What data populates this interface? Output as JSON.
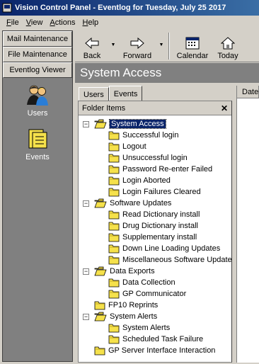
{
  "window": {
    "title": "Vision Control Panel - Eventlog for Tuesday, July  25 2017"
  },
  "menu": [
    {
      "pre": "",
      "key": "F",
      "post": "ile"
    },
    {
      "pre": "",
      "key": "V",
      "post": "iew"
    },
    {
      "pre": "",
      "key": "A",
      "post": "ctions"
    },
    {
      "pre": "",
      "key": "H",
      "post": "elp"
    }
  ],
  "sidebar": {
    "buttons": [
      "Mail Maintenance",
      "File Maintenance",
      "Eventlog Viewer"
    ],
    "items": [
      {
        "label": "Users",
        "icon": "users-icon"
      },
      {
        "label": "Events",
        "icon": "events-icon"
      }
    ]
  },
  "toolbar": {
    "back": "Back",
    "forward": "Forward",
    "calendar": "Calendar",
    "today": "Today"
  },
  "header": {
    "title": "System Access"
  },
  "tabs": [
    "Users",
    "Events"
  ],
  "panel": {
    "title": "Folder Items",
    "close": "✕"
  },
  "right": {
    "column": "Date"
  },
  "tree": [
    {
      "label": "System Access",
      "level": 0,
      "expanded": true,
      "selected": true
    },
    {
      "label": "Successful login",
      "level": 1
    },
    {
      "label": "Logout",
      "level": 1
    },
    {
      "label": "Unsuccessful login",
      "level": 1
    },
    {
      "label": "Password Re-enter Failed",
      "level": 1
    },
    {
      "label": "Login Aborted",
      "level": 1
    },
    {
      "label": "Login Failures Cleared",
      "level": 1
    },
    {
      "label": "Software Updates",
      "level": 0,
      "expanded": true
    },
    {
      "label": "Read Dictionary install",
      "level": 1
    },
    {
      "label": "Drug Dictionary install",
      "level": 1
    },
    {
      "label": "Supplementary install",
      "level": 1
    },
    {
      "label": "Down Line Loading Updates",
      "level": 1
    },
    {
      "label": "Miscellaneous Software Updates",
      "level": 1
    },
    {
      "label": "Data Exports",
      "level": 0,
      "expanded": true
    },
    {
      "label": "Data Collection",
      "level": 1
    },
    {
      "label": "GP Communicator",
      "level": 1
    },
    {
      "label": "FP10 Reprints",
      "level": 0
    },
    {
      "label": "System Alerts",
      "level": 0,
      "expanded": true
    },
    {
      "label": "System Alerts",
      "level": 1
    },
    {
      "label": "Scheduled Task Failure",
      "level": 1
    },
    {
      "label": "GP Server Interface Interaction",
      "level": 0
    }
  ],
  "colors": {
    "title_bar": "#0a246a",
    "selection": "#0a246a",
    "folder": "#f5e14b"
  }
}
